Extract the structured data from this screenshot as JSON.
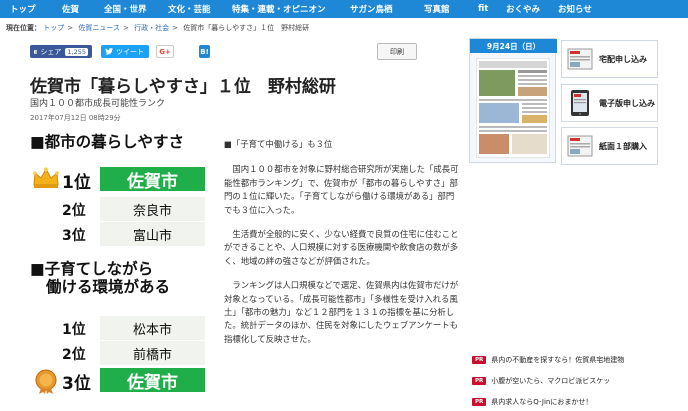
{
  "nav": {
    "items": [
      "トップ",
      "佐賀",
      "全国・世界",
      "文化・芸能",
      "特集・連載・オピニオン",
      "サガン鳥栖",
      "写真館",
      "fit",
      "おくやみ",
      "お知らせ"
    ]
  },
  "breadcrumb": {
    "lead": "現在位置：",
    "items": [
      "トップ",
      "佐賀ニュース",
      "行政・社会",
      "佐賀市「暮らしやすさ」１位　野村総研"
    ]
  },
  "share": {
    "facebook_label": "シェア",
    "facebook_count": "1,255",
    "tweet_label": "ツイート",
    "gplus_label": "G+",
    "hatena_label": "B!",
    "print_label": "印刷"
  },
  "article": {
    "title": "佐賀市「暮らしやすさ」１位　野村総研",
    "subtitle": "国内１００都市成長可能性ランク",
    "date": "2017年07月12日 08時29分",
    "subheading": "■「子育て中働ける」も３位",
    "paragraphs": [
      "国内１００都市を対象に野村総合研究所が実施した「成長可能性都市ランキング」で、佐賀市が「都市の暮らしやすさ」部門の１位に輝いた。「子育てしながら働ける環境がある」部門でも３位に入った。",
      "生活費が全般的に安く、少ない経費で良質の住宅に住むことができることや、人口規模に対する医療機関や飲食店の数が多く、地域の絆の強さなどが評価された。",
      "ランキングは人口規模などで選定、佐賀県内は佐賀市だけが対象となっている。「成長可能性都市」「多様性を受け入れる風土」「都市の魅力」など１２部門を１３１の指標を基に分析した。統計データのほか、住民を対象にしたウェブアンケートも指標化して反映させた。"
    ]
  },
  "graphic": {
    "heading1": "■都市の暮らしやすさ",
    "ranking1": [
      {
        "rank": "1位",
        "city": "佐賀市"
      },
      {
        "rank": "2位",
        "city": "奈良市"
      },
      {
        "rank": "3位",
        "city": "富山市"
      }
    ],
    "heading2_line1": "■子育てしながら",
    "heading2_line2": "働ける環境がある",
    "ranking2": [
      {
        "rank": "1位",
        "city": "松本市"
      },
      {
        "rank": "2位",
        "city": "前橋市"
      },
      {
        "rank": "3位",
        "city": "佐賀市"
      }
    ],
    "highlight_color": "#1fae4a"
  },
  "sidebar": {
    "paper_date": "9月24日（日）",
    "buttons": [
      {
        "label": "宅配申し込み",
        "icon": "newspaper-icon"
      },
      {
        "label": "電子版申し込み",
        "icon": "smartphone-icon"
      },
      {
        "label": "紙面１部購入",
        "icon": "newspaper-icon"
      }
    ],
    "pr_badge": "PR",
    "pr_items": [
      "県内の不動産を探すなら！佐賀県宅地建物",
      "小腹が空いたら、マクロビ派ビスケッ",
      "県内求人ならQ-Jinにおまかせ！"
    ]
  },
  "colors": {
    "nav": "#1e88d6",
    "facebook": "#3b5998",
    "twitter": "#1da1f2",
    "pr": "#c8102e"
  }
}
